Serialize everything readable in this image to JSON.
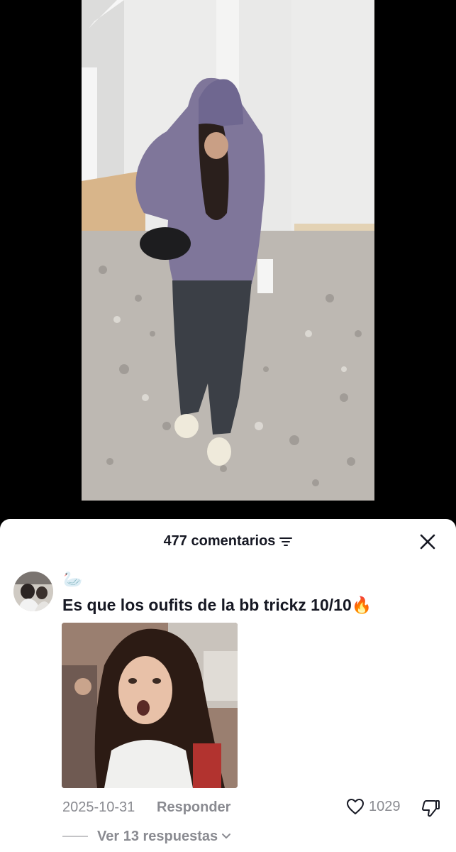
{
  "video": {
    "alt_icon": "video-frame"
  },
  "comments_panel": {
    "count_label": "477 comentarios",
    "filter_icon": "filter-icon",
    "close_icon": "close-icon"
  },
  "comment": {
    "username": "🦢",
    "text": "Es que los oufits de la bb trickz 10/10🔥",
    "date": "2025-10-31",
    "reply_label": "Responder",
    "like_count": "1029",
    "view_replies_label": "Ver 13 respuestas",
    "icons": {
      "like": "heart-icon",
      "dislike": "thumbs-down-icon",
      "expand": "chevron-down-icon"
    }
  },
  "colors": {
    "text_primary": "#161823",
    "text_secondary": "#8a8b91",
    "sheet_background": "#ffffff",
    "page_background": "#000000"
  }
}
